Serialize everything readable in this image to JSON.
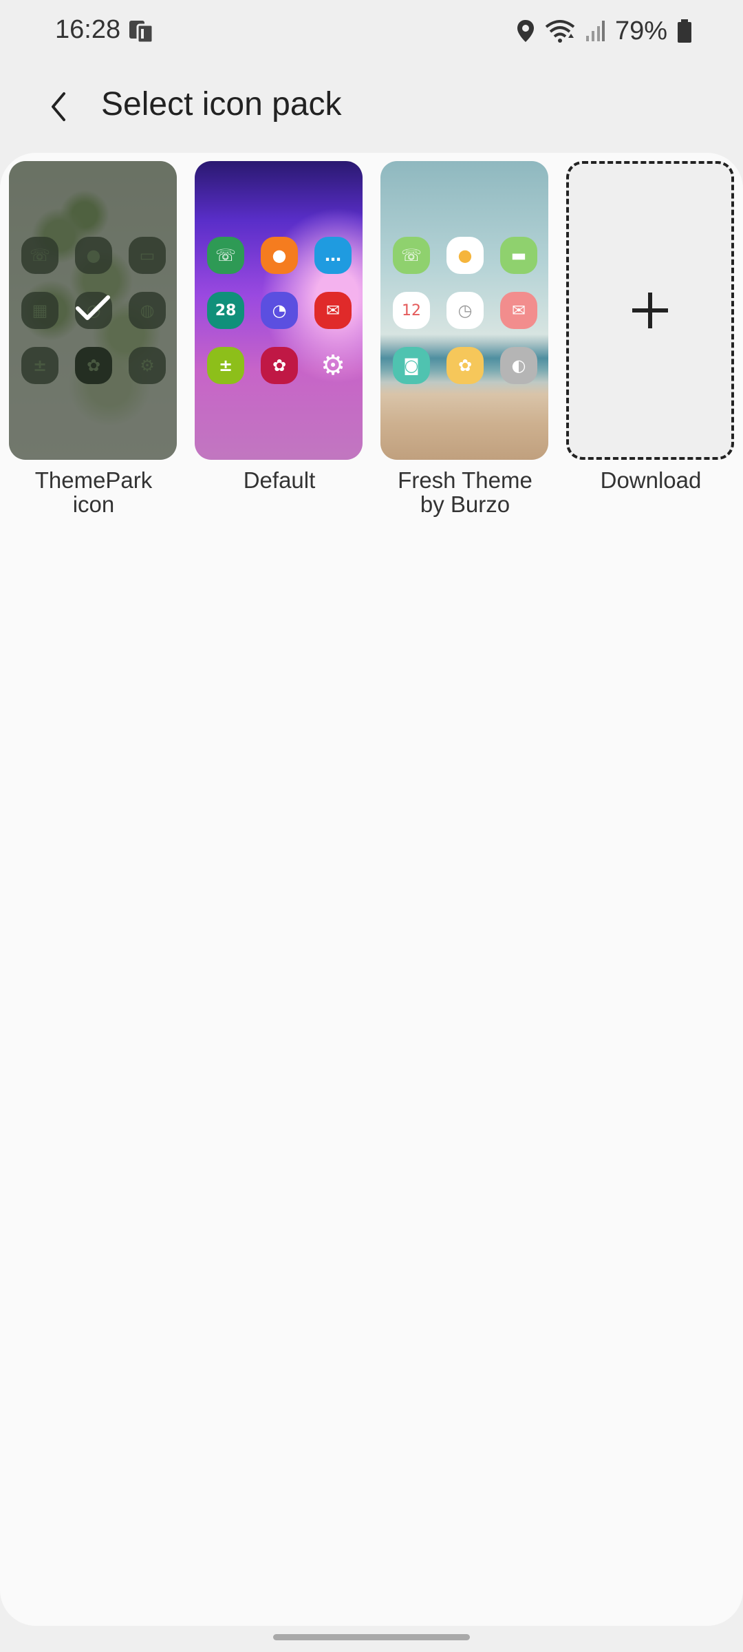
{
  "status_bar": {
    "time": "16:28",
    "battery_percent": "79%",
    "icons": [
      "data-transfer-icon",
      "location-icon",
      "wifi-icon",
      "signal-icon",
      "battery-icon"
    ]
  },
  "header": {
    "title": "Select icon pack",
    "back_icon": "back-arrow-icon"
  },
  "icon_packs": [
    {
      "label_line1": "ThemePark",
      "label_line2": "icon",
      "selected": true,
      "icon_colors": [
        "#3c4b37",
        "#3c4b37",
        "#3c4b37",
        "#3c4b37",
        "#3c4b37",
        "#3c4b37",
        "#3c4b37",
        "#3c4b37",
        "#3c4b37"
      ]
    },
    {
      "label_line1": "Default",
      "label_line2": "",
      "selected": false,
      "calendar_day": "28",
      "icon_colors": [
        "#2e9a55",
        "#f57c1f",
        "#1f9be0",
        "#10907a",
        "#5b4fe0",
        "#e02a2a",
        "#8dbf1a",
        "#c01845",
        "#ffffff"
      ]
    },
    {
      "label_line1": "Fresh Theme",
      "label_line2": "by Burzo",
      "selected": false,
      "calendar_day": "12",
      "icon_colors": [
        "#8fd16e",
        "#ffffff",
        "#8fd16e",
        "#ffffff",
        "#ffffff",
        "#f28d8d",
        "#4fc3b0",
        "#f6c75a",
        "#b5b5b5"
      ]
    },
    {
      "label_line1": "Download",
      "label_line2": "",
      "selected": false
    }
  ],
  "accent_colors": {
    "background": "#efefef",
    "card": "#fafafa",
    "text": "#222222"
  }
}
